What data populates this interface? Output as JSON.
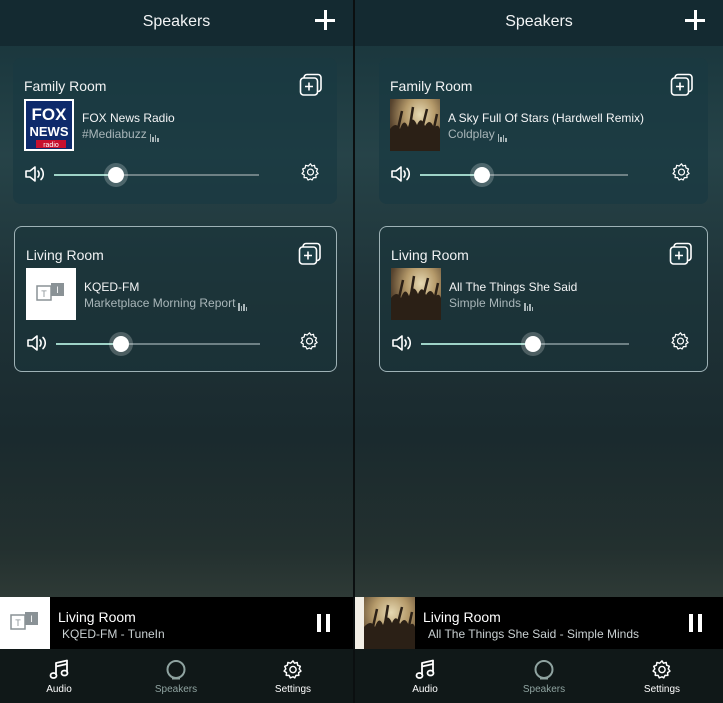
{
  "left": {
    "header": {
      "title": "Speakers"
    },
    "cards": [
      {
        "room": "Family Room",
        "track": "FOX News Radio",
        "artist": "#Mediabuzz",
        "volume": 0.3,
        "art": "fox-news-radio-logo",
        "outlined": false
      },
      {
        "room": "Living Room",
        "track": "KQED-FM",
        "artist": "Marketplace Morning Report",
        "volume": 0.32,
        "art": "tunein-logo",
        "outlined": true
      }
    ],
    "now_playing": {
      "room": "Living Room",
      "subtitle": "KQED-FM - TuneIn",
      "art": "tunein-logo"
    },
    "tabs": [
      {
        "label": "Audio",
        "icon": "music-note-icon"
      },
      {
        "label": "Speakers",
        "icon": "speaker-ring-icon",
        "active": true
      },
      {
        "label": "Settings",
        "icon": "gear-icon"
      }
    ]
  },
  "right": {
    "header": {
      "title": "Speakers"
    },
    "cards": [
      {
        "room": "Family Room",
        "track": "A Sky Full Of Stars (Hardwell Remix)",
        "artist": "Coldplay",
        "volume": 0.3,
        "art": "concert-crowd-album-art",
        "outlined": false
      },
      {
        "room": "Living Room",
        "track": "All The Things She Said",
        "artist": "Simple Minds",
        "volume": 0.54,
        "art": "concert-crowd-album-art",
        "outlined": true
      }
    ],
    "now_playing": {
      "room": "Living Room",
      "subtitle": "All The Things She Said - Simple Minds",
      "art": "concert-crowd-album-art"
    },
    "tabs": [
      {
        "label": "Audio",
        "icon": "music-note-icon"
      },
      {
        "label": "Speakers",
        "icon": "speaker-ring-icon",
        "active": true
      },
      {
        "label": "Settings",
        "icon": "gear-icon"
      }
    ]
  },
  "colors": {
    "accent": "#9ed3c7",
    "header_bg": "#142a31",
    "card_bg": "#193a42",
    "card_border": "#9eb2b6",
    "inactive_tab": "#8fa3a0"
  }
}
